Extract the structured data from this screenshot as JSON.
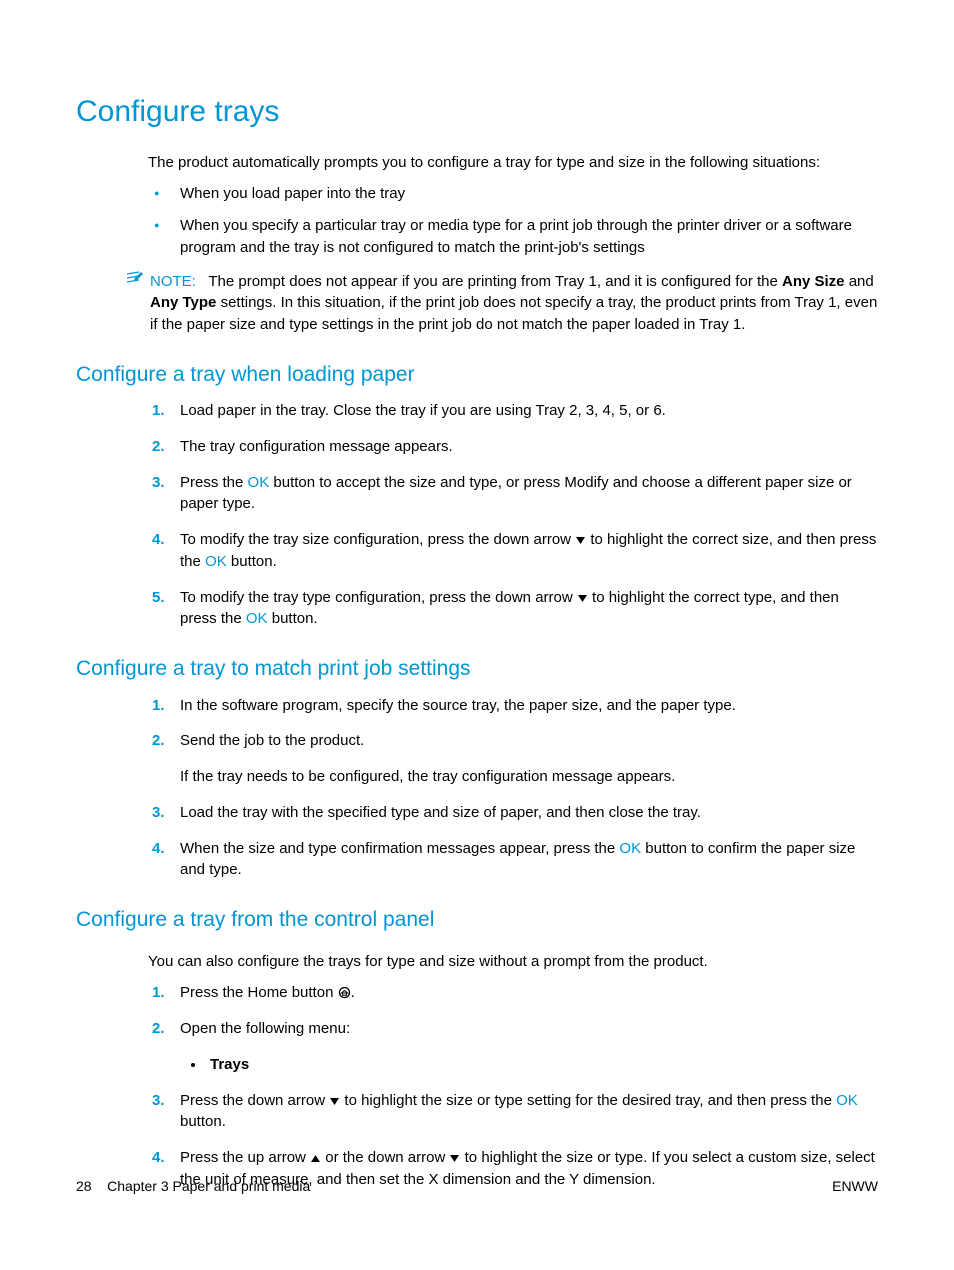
{
  "title": "Configure trays",
  "intro": "The product automatically prompts you to configure a tray for type and size in the following situations:",
  "bullets": [
    "When you load paper into the tray",
    "When you specify a particular tray or media type for a print job through the printer driver or a software program and the tray is not configured to match the print-job's settings"
  ],
  "note": {
    "label": "NOTE:",
    "pre": "The prompt does not appear if you are printing from Tray 1, and it is configured for the ",
    "b1": "Any Size",
    "mid": " and ",
    "b2": "Any Type",
    "post": " settings. In this situation, if the print job does not specify a tray, the product prints from Tray 1, even if the paper size and type settings in the print job do not match the paper loaded in Tray 1."
  },
  "section1": {
    "heading": "Configure a tray when loading paper",
    "s1": "Load paper in the tray. Close the tray if you are using Tray 2, 3, 4, 5, or 6.",
    "s2": "The tray configuration message appears.",
    "s3a": "Press the ",
    "ok": "OK",
    "s3b": " button to accept the size and type, or press Modify and choose a different paper size or paper type.",
    "s4a": "To modify the tray size configuration, press the down arrow ",
    "s4b": " to highlight the correct size, and then press the ",
    "s4c": " button.",
    "s5a": "To modify the tray type configuration, press the down arrow ",
    "s5b": " to highlight the correct type, and then press the ",
    "s5c": " button."
  },
  "section2": {
    "heading": "Configure a tray to match print job settings",
    "s1": "In the software program, specify the source tray, the paper size, and the paper type.",
    "s2": "Send the job to the product.",
    "s2b": "If the tray needs to be configured, the tray configuration message appears.",
    "s3": "Load the tray with the specified type and size of paper, and then close the tray.",
    "s4a": "When the size and type confirmation messages appear, press the ",
    "ok": "OK",
    "s4b": " button to confirm the paper size and type."
  },
  "section3": {
    "heading": "Configure a tray from the control panel",
    "intro": "You can also configure the trays for type and size without a prompt from the product.",
    "s1a": "Press the Home button ",
    "s1b": ".",
    "s2": "Open the following menu:",
    "s2item": "Trays",
    "s3a": "Press the down arrow ",
    "s3b": " to highlight the size or type setting for the desired tray, and then press the ",
    "ok": "OK",
    "s3c": " button.",
    "s4a": "Press the up arrow ",
    "s4b": " or the down arrow ",
    "s4c": " to highlight the size or type. If you select a custom size, select the unit of measure, and then set the X dimension and the Y dimension."
  },
  "footer": {
    "page": "28",
    "chapter": "Chapter 3   Paper and print media",
    "right": "ENWW"
  }
}
